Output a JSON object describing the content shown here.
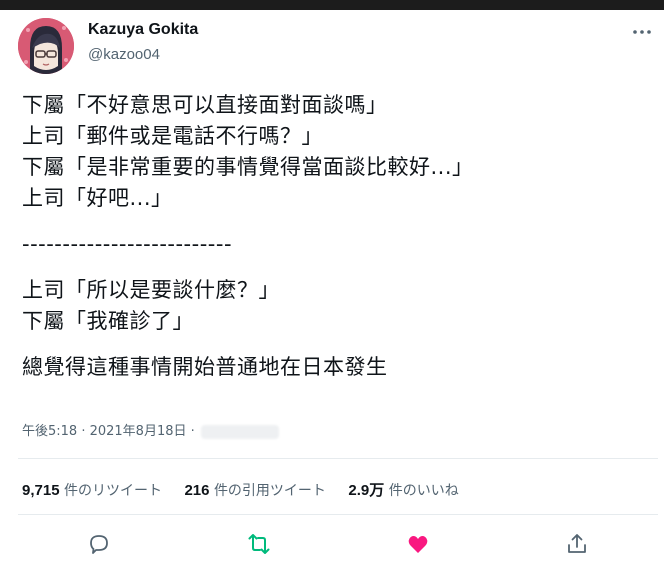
{
  "tweet": {
    "author_name": "Kazuya Gokita",
    "author_handle": "@kazoo04",
    "lines": [
      "下屬「不好意思可以直接面對面談嗎」",
      "上司「郵件或是電話不行嗎？」",
      "下屬「是非常重要的事情覺得當面談比較好...」",
      "上司「好吧...」",
      "",
      "--------------------------",
      "",
      "上司「所以是要談什麼？」",
      "下屬「我確診了」",
      "",
      "總覺得這種事情開始普通地在日本發生"
    ],
    "timestamp": "午後5:18 · 2021年8月18日 ·"
  },
  "stats": {
    "retweets_count": "9,715",
    "retweets_label": "件のリツイート",
    "quotes_count": "216",
    "quotes_label": "件の引用ツイート",
    "likes_count": "2.9万",
    "likes_label": "件のいいね"
  },
  "actions": {
    "reply_icon": "reply-icon",
    "retweet_icon": "retweet-icon",
    "like_icon": "heart-icon",
    "share_icon": "share-icon"
  },
  "colors": {
    "text": "#0f1419",
    "secondary": "#536471",
    "retweet_green": "#00ba7c",
    "like_red": "#f91880"
  }
}
